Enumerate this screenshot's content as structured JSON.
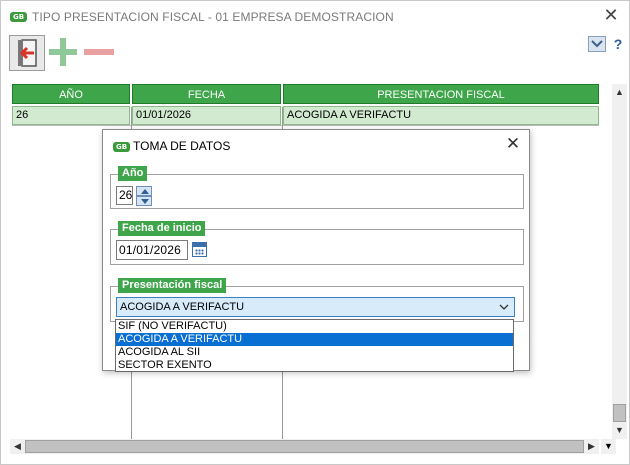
{
  "window": {
    "title": "TIPO PRESENTACION FISCAL - 01 EMPRESA DEMOSTRACION",
    "logo_text": "GB",
    "close_glyph": "✕"
  },
  "toolbar": {
    "exit_icon": "exit-door-icon",
    "add_icon": "plus-icon",
    "remove_icon": "minus-icon",
    "collapse_glyph": "⌄",
    "help_glyph": "?"
  },
  "grid": {
    "columns": [
      "AÑO",
      "FECHA",
      "PRESENTACION FISCAL"
    ],
    "rows": [
      [
        "26",
        "01/01/2026",
        "ACOGIDA A VERIFACTU"
      ]
    ]
  },
  "scrollbars": {
    "up_glyph": "▲",
    "down_glyph": "▼",
    "left_glyph": "◀",
    "right_glyph": "▶"
  },
  "dialog": {
    "title": "TOMA DE DATOS",
    "logo_text": "GB",
    "close_glyph": "✕",
    "year": {
      "label": "Año",
      "value": "26"
    },
    "start_date": {
      "label": "Fecha de inicio",
      "value": "01/01/2026"
    },
    "fiscal": {
      "label": "Presentación fiscal",
      "selected": "ACOGIDA A VERIFACTU",
      "chevron": "⌄",
      "options": [
        "SIF (NO VERIFACTU)",
        "ACOGIDA A VERIFACTU",
        "ACOGIDA AL SII",
        "SECTOR EXENTO"
      ],
      "highlighted_index": 1
    }
  },
  "colors": {
    "header_green": "#3ea54a",
    "row_green": "#d2ead0",
    "selection_blue": "#0a6fd3",
    "select_bg": "#d7ebfa"
  }
}
